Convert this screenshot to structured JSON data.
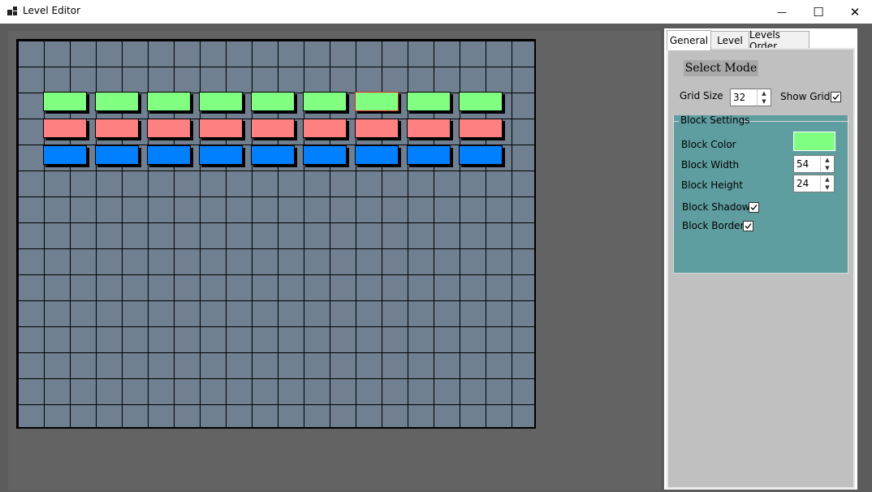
{
  "window": {
    "title": "Level Editor",
    "controls": {
      "minimize": "—",
      "maximize": "☐",
      "close": "✕"
    }
  },
  "tabs": [
    {
      "label": "General",
      "active": true
    },
    {
      "label": "Level",
      "active": false
    },
    {
      "label": "Levels Order",
      "active": false
    }
  ],
  "general": {
    "select_mode_label": "Select Mode",
    "grid_size_label": "Grid Size",
    "grid_size_value": "32",
    "show_grid_label": "Show Grid",
    "show_grid_checked": true,
    "block_settings": {
      "title": "Block Settings",
      "block_color_label": "Block Color",
      "block_color": "#80ff80",
      "block_width_label": "Block Width",
      "block_width_value": "54",
      "block_height_label": "Block Height",
      "block_height_value": "24",
      "block_shadow_label": "Block Shadow",
      "block_shadow_checked": true,
      "block_border_label": "Block Border",
      "block_border_checked": true
    }
  },
  "level": {
    "grid_columns": 20,
    "grid_rows": 15,
    "grid_color": "#708090",
    "block_rows": [
      {
        "row": 2,
        "color": "#80ff80",
        "start_column": 1,
        "count": 9,
        "selected_index": 6
      },
      {
        "row": 3,
        "color": "#ff8080",
        "start_column": 1,
        "count": 9
      },
      {
        "row": 4,
        "color": "#0080ff",
        "start_column": 1,
        "count": 9
      }
    ]
  }
}
